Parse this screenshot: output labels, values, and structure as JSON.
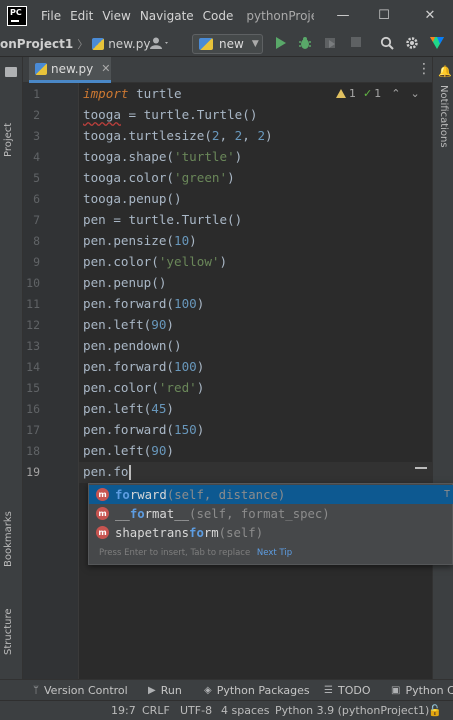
{
  "app": {
    "logo_text": "PC",
    "menu": [
      "File",
      "Edit",
      "View",
      "Navigate",
      "Code"
    ],
    "window_title": "pythonProjec"
  },
  "window_controls": {
    "minimize": "—",
    "maximize": "☐",
    "close": "✕"
  },
  "nav": {
    "project": "onProject1",
    "separator": "〉",
    "file": "new.py",
    "run_config": "new"
  },
  "left_panel": {
    "project": "Project",
    "bookmarks": "Bookmarks",
    "structure": "Structure"
  },
  "right_panel": {
    "notifications": "Notifications"
  },
  "tabs": [
    {
      "label": "new.py"
    }
  ],
  "inspections": {
    "warnings": "1",
    "weak_warnings": "1"
  },
  "editor": {
    "line_numbers": [
      "1",
      "2",
      "3",
      "4",
      "5",
      "6",
      "7",
      "8",
      "9",
      "10",
      "11",
      "12",
      "13",
      "14",
      "15",
      "16",
      "17",
      "18",
      "19"
    ],
    "current_line_text": "pen.fo"
  },
  "completion": {
    "items": [
      {
        "match": "fo",
        "rest": "rward",
        "signature": "(self, distance)",
        "type": "T"
      },
      {
        "match": "",
        "rest": "__format__",
        "signature": "(self, format_spec)",
        "type": ""
      },
      {
        "match": "",
        "rest": "shapetransform",
        "signature": "(self)",
        "type": ""
      }
    ],
    "hint": "Press Enter to insert, Tab to replace",
    "next_tip": "Next Tip"
  },
  "tool_windows": {
    "version_control": "Version Control",
    "run": "Run",
    "python_packages": "Python Packages",
    "todo": "TODO",
    "python_console": "Python C"
  },
  "status": {
    "position": "19:7",
    "line_sep": "CRLF",
    "encoding": "UTF-8",
    "indent": "4 spaces",
    "interpreter": "Python 3.9 (pythonProject1)"
  },
  "colors": {
    "editor_bg": "#2b2b2b",
    "keyword": "#cc7832",
    "string": "#6a8759",
    "number": "#6897bb",
    "identifier": "#a9b7c6",
    "selection": "#0d5991",
    "accent": "#4a88c7"
  }
}
